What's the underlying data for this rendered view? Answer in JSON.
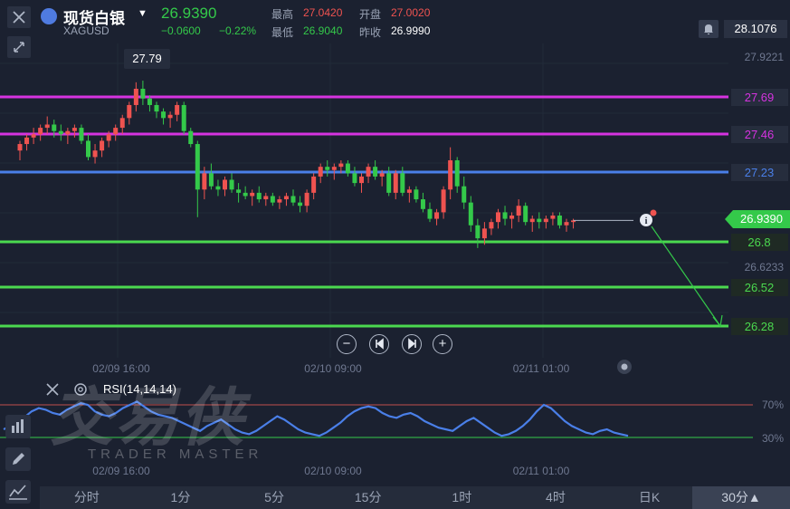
{
  "header": {
    "symbol_name": "现货白银",
    "symbol_code": "XAGUSD",
    "price": "26.9390",
    "change_abs": "−0.0600",
    "change_pct": "−0.22%",
    "high_label": "最高",
    "high_value": "27.0420",
    "open_label": "开盘",
    "open_value": "27.0020",
    "low_label": "最低",
    "low_value": "26.9040",
    "prev_close_label": "昨收",
    "prev_close_value": "26.9990",
    "top_axis_value": "28.1076"
  },
  "chart_data": {
    "type": "candlestick",
    "y_ticks": [
      "27.9221",
      "26.6233"
    ],
    "x_ticks": [
      "02/09 16:00",
      "02/10 09:00",
      "02/11 01:00"
    ],
    "peak_label": "27.79",
    "current_price": "26.9390",
    "levels": [
      {
        "value": 27.69,
        "label": "27.69",
        "color": "#d633e0"
      },
      {
        "value": 27.46,
        "label": "27.46",
        "color": "#d633e0"
      },
      {
        "value": 27.23,
        "label": "27.23",
        "color": "#4a7fe8"
      },
      {
        "value": 26.8,
        "label": "26.8",
        "color": "#4bd94f"
      },
      {
        "value": 26.52,
        "label": "26.52",
        "color": "#4bd94f"
      },
      {
        "value": 26.28,
        "label": "26.28",
        "color": "#4bd94f"
      }
    ],
    "arrow": {
      "from": 26.93,
      "to": 26.28
    },
    "candles": [
      [
        27.36,
        27.42,
        27.3,
        27.4
      ],
      [
        27.4,
        27.46,
        27.36,
        27.44
      ],
      [
        27.44,
        27.5,
        27.4,
        27.46
      ],
      [
        27.46,
        27.52,
        27.42,
        27.5
      ],
      [
        27.5,
        27.57,
        27.46,
        27.52
      ],
      [
        27.52,
        27.55,
        27.44,
        27.48
      ],
      [
        27.48,
        27.52,
        27.42,
        27.46
      ],
      [
        27.46,
        27.5,
        27.4,
        27.48
      ],
      [
        27.48,
        27.52,
        27.44,
        27.5
      ],
      [
        27.5,
        27.52,
        27.4,
        27.42
      ],
      [
        27.42,
        27.46,
        27.3,
        27.32
      ],
      [
        27.32,
        27.4,
        27.28,
        27.36
      ],
      [
        27.36,
        27.44,
        27.32,
        27.42
      ],
      [
        27.42,
        27.48,
        27.38,
        27.46
      ],
      [
        27.46,
        27.52,
        27.42,
        27.5
      ],
      [
        27.5,
        27.58,
        27.46,
        27.56
      ],
      [
        27.56,
        27.66,
        27.52,
        27.64
      ],
      [
        27.64,
        27.78,
        27.6,
        27.74
      ],
      [
        27.74,
        27.79,
        27.64,
        27.68
      ],
      [
        27.68,
        27.7,
        27.6,
        27.64
      ],
      [
        27.64,
        27.66,
        27.56,
        27.6
      ],
      [
        27.6,
        27.62,
        27.52,
        27.56
      ],
      [
        27.56,
        27.6,
        27.5,
        27.58
      ],
      [
        27.58,
        27.66,
        27.54,
        27.64
      ],
      [
        27.64,
        27.66,
        27.46,
        27.48
      ],
      [
        27.48,
        27.5,
        27.38,
        27.4
      ],
      [
        27.4,
        27.42,
        26.95,
        27.12
      ],
      [
        27.12,
        27.26,
        27.06,
        27.22
      ],
      [
        27.22,
        27.28,
        27.12,
        27.14
      ],
      [
        27.14,
        27.18,
        27.08,
        27.12
      ],
      [
        27.12,
        27.2,
        27.08,
        27.18
      ],
      [
        27.18,
        27.22,
        27.1,
        27.12
      ],
      [
        27.12,
        27.16,
        27.04,
        27.1
      ],
      [
        27.1,
        27.14,
        27.06,
        27.08
      ],
      [
        27.08,
        27.12,
        27.02,
        27.1
      ],
      [
        27.1,
        27.14,
        27.04,
        27.06
      ],
      [
        27.06,
        27.1,
        27.02,
        27.08
      ],
      [
        27.08,
        27.1,
        27.02,
        27.04
      ],
      [
        27.04,
        27.08,
        27.0,
        27.06
      ],
      [
        27.06,
        27.1,
        27.02,
        27.08
      ],
      [
        27.08,
        27.12,
        27.02,
        27.04
      ],
      [
        27.04,
        27.08,
        26.98,
        27.02
      ],
      [
        27.02,
        27.12,
        26.98,
        27.1
      ],
      [
        27.1,
        27.22,
        27.06,
        27.2
      ],
      [
        27.2,
        27.28,
        27.16,
        27.26
      ],
      [
        27.26,
        27.3,
        27.2,
        27.24
      ],
      [
        27.24,
        27.28,
        27.18,
        27.26
      ],
      [
        27.26,
        27.3,
        27.22,
        27.28
      ],
      [
        27.28,
        27.3,
        27.2,
        27.22
      ],
      [
        27.22,
        27.26,
        27.14,
        27.16
      ],
      [
        27.16,
        27.22,
        27.1,
        27.2
      ],
      [
        27.2,
        27.28,
        27.16,
        27.26
      ],
      [
        27.26,
        27.3,
        27.18,
        27.2
      ],
      [
        27.2,
        27.24,
        27.14,
        27.22
      ],
      [
        27.22,
        27.26,
        27.08,
        27.1
      ],
      [
        27.1,
        27.24,
        27.06,
        27.22
      ],
      [
        27.22,
        27.26,
        27.08,
        27.1
      ],
      [
        27.1,
        27.14,
        27.04,
        27.12
      ],
      [
        27.12,
        27.14,
        27.04,
        27.06
      ],
      [
        27.06,
        27.1,
        26.98,
        27.0
      ],
      [
        27.0,
        27.04,
        26.92,
        26.94
      ],
      [
        26.94,
        27.0,
        26.9,
        26.98
      ],
      [
        26.98,
        27.14,
        26.94,
        27.12
      ],
      [
        27.12,
        27.38,
        27.06,
        27.3
      ],
      [
        27.3,
        27.32,
        27.1,
        27.14
      ],
      [
        27.14,
        27.2,
        27.0,
        27.04
      ],
      [
        27.04,
        27.08,
        26.86,
        26.9
      ],
      [
        26.9,
        26.94,
        26.76,
        26.82
      ],
      [
        26.82,
        26.92,
        26.78,
        26.88
      ],
      [
        26.88,
        26.94,
        26.84,
        26.92
      ],
      [
        26.92,
        27.0,
        26.88,
        26.98
      ],
      [
        26.98,
        27.02,
        26.9,
        26.94
      ],
      [
        26.94,
        26.98,
        26.88,
        26.96
      ],
      [
        26.96,
        27.06,
        26.92,
        27.02
      ],
      [
        27.02,
        27.04,
        26.9,
        26.92
      ],
      [
        26.92,
        26.96,
        26.86,
        26.94
      ],
      [
        26.94,
        26.98,
        26.88,
        26.92
      ],
      [
        26.92,
        26.96,
        26.88,
        26.94
      ],
      [
        26.94,
        26.98,
        26.9,
        26.96
      ],
      [
        26.96,
        26.98,
        26.88,
        26.9
      ],
      [
        26.9,
        26.94,
        26.86,
        26.92
      ],
      [
        26.92,
        26.94,
        26.88,
        26.93
      ]
    ],
    "rsi": {
      "label": "RSI(14,14,14)",
      "levels": [
        "70%",
        "30%"
      ],
      "values": [
        40,
        44,
        48,
        55,
        62,
        66,
        64,
        60,
        58,
        64,
        68,
        72,
        70,
        62,
        58,
        56,
        60,
        66,
        70,
        74,
        68,
        62,
        58,
        56,
        54,
        50,
        46,
        42,
        38,
        44,
        48,
        52,
        46,
        40,
        36,
        34,
        38,
        44,
        50,
        56,
        52,
        46,
        40,
        36,
        34,
        32,
        36,
        42,
        48,
        56,
        62,
        66,
        68,
        66,
        60,
        56,
        54,
        58,
        60,
        56,
        50,
        46,
        42,
        40,
        38,
        44,
        50,
        54,
        48,
        42,
        36,
        32,
        34,
        38,
        44,
        52,
        62,
        70,
        66,
        58,
        50,
        44,
        40,
        36,
        34,
        38,
        40,
        36,
        34,
        32
      ]
    }
  },
  "rsi_panel": {
    "label": "RSI(14,14,14)"
  },
  "watermark": {
    "cn": "交易侠",
    "en": "TRADER MASTER"
  },
  "tabs": [
    "分时",
    "1分",
    "5分",
    "15分",
    "1时",
    "4时",
    "日K",
    "30分▲"
  ]
}
